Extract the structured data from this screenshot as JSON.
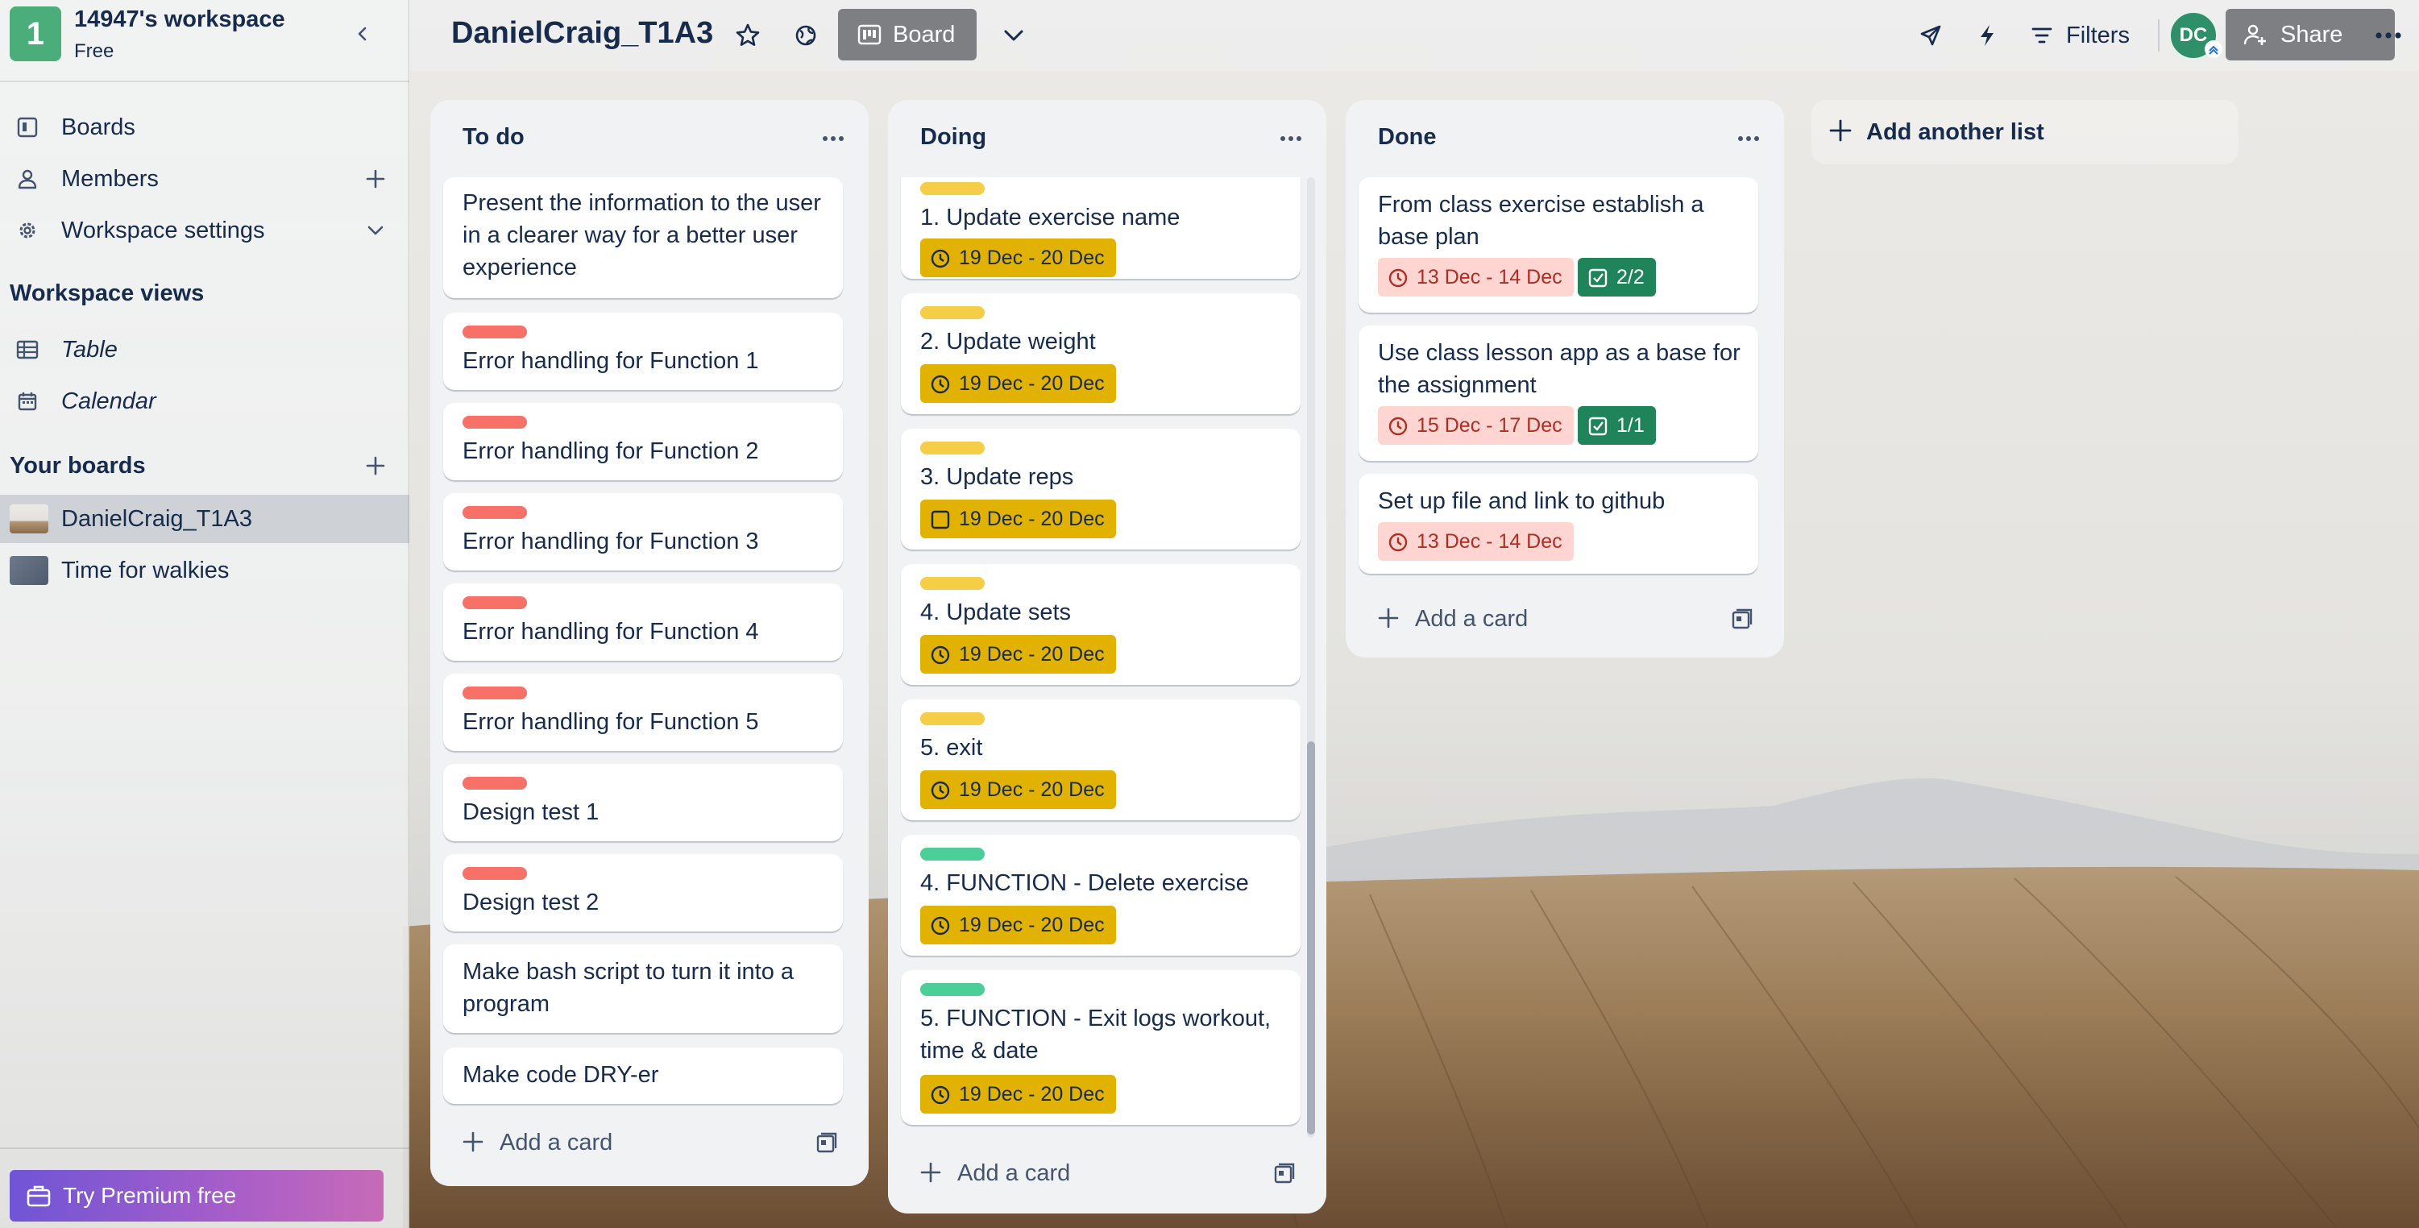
{
  "workspace": {
    "logo_letter": "1",
    "name": "14947's workspace",
    "plan": "Free"
  },
  "sidebar": {
    "items": [
      {
        "label": "Boards",
        "icon": "board-icon"
      },
      {
        "label": "Members",
        "icon": "person-icon"
      },
      {
        "label": "Workspace settings",
        "icon": "gear-icon"
      }
    ],
    "views_title": "Workspace views",
    "views": [
      {
        "label": "Table",
        "icon": "table-icon"
      },
      {
        "label": "Calendar",
        "icon": "calendar-icon"
      }
    ],
    "boards_title": "Your boards",
    "boards": [
      {
        "label": "DanielCraig_T1A3",
        "active": true
      },
      {
        "label": "Time for walkies",
        "active": false
      }
    ],
    "premium_label": "Try Premium free"
  },
  "header": {
    "board_title": "DanielCraig_T1A3",
    "view_label": "Board",
    "filters_label": "Filters",
    "avatar_initials": "DC",
    "share_label": "Share"
  },
  "colors": {
    "label_red": "#f87168",
    "label_yellow": "#f5cd47",
    "label_green": "#4bce97",
    "badge_yellow": "#e2b203",
    "badge_red_bg": "#ffd5d2",
    "badge_green": "#1f845a"
  },
  "lists": [
    {
      "title": "To do",
      "add_card_label": "Add a card",
      "cards": [
        {
          "title": "Present the information to the user in a clearer way for a better user experience",
          "label": null
        },
        {
          "title": "Error handling for Function 1",
          "label": "red"
        },
        {
          "title": "Error handling for Function 2",
          "label": "red"
        },
        {
          "title": "Error handling for Function 3",
          "label": "red"
        },
        {
          "title": "Error handling for Function 4",
          "label": "red"
        },
        {
          "title": "Error handling for Function 5",
          "label": "red"
        },
        {
          "title": "Design test 1",
          "label": "red"
        },
        {
          "title": "Design test 2",
          "label": "red"
        },
        {
          "title": "Make bash script to turn it into a program",
          "label": null
        },
        {
          "title": "Make code DRY-er",
          "label": null
        }
      ]
    },
    {
      "title": "Doing",
      "add_card_label": "Add a card",
      "cards": [
        {
          "title": "1. Update exercise name",
          "label": "yellow",
          "dates": "19 Dec - 20 Dec",
          "date_icon": "clock-icon"
        },
        {
          "title": "2. Update weight",
          "label": "yellow",
          "dates": "19 Dec - 20 Dec",
          "date_icon": "clock-icon"
        },
        {
          "title": "3. Update reps",
          "label": "yellow",
          "dates": "19 Dec - 20 Dec",
          "date_icon": "checkbox-icon"
        },
        {
          "title": "4. Update sets",
          "label": "yellow",
          "dates": "19 Dec - 20 Dec",
          "date_icon": "clock-icon"
        },
        {
          "title": "5. exit",
          "label": "yellow",
          "dates": "19 Dec - 20 Dec",
          "date_icon": "clock-icon"
        },
        {
          "title": "4. FUNCTION - Delete exercise",
          "label": "green",
          "dates": "19 Dec - 20 Dec",
          "date_icon": "clock-icon"
        },
        {
          "title": "5. FUNCTION - Exit logs workout, time & date",
          "label": "green",
          "dates": "19 Dec - 20 Dec",
          "date_icon": "clock-icon"
        }
      ]
    },
    {
      "title": "Done",
      "add_card_label": "Add a card",
      "cards": [
        {
          "title": "From class exercise establish a base plan",
          "dates": "13 Dec - 14 Dec",
          "checklist": "2/2"
        },
        {
          "title": "Use class lesson app as a base for the assignment",
          "dates": "15 Dec - 17 Dec",
          "checklist": "1/1"
        },
        {
          "title": "Set up file and link to github",
          "dates": "13 Dec - 14 Dec"
        }
      ]
    }
  ],
  "add_list_label": "Add another list"
}
